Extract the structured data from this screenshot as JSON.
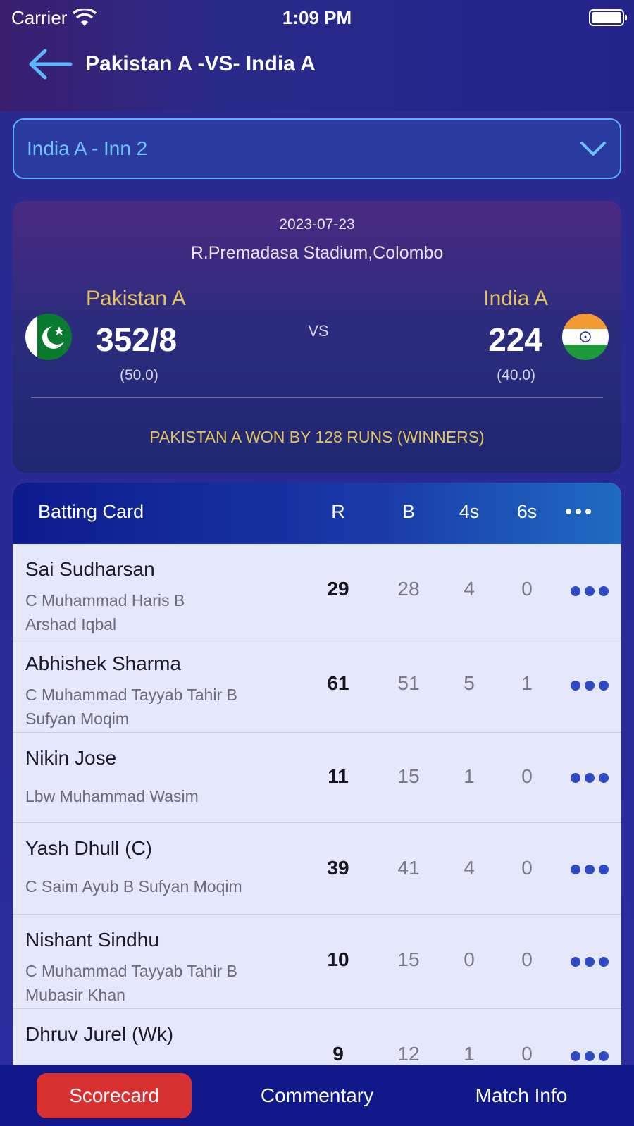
{
  "status_bar": {
    "carrier": "Carrier",
    "time": "1:09 PM"
  },
  "header": {
    "title": "Pakistan A -VS- India A",
    "back_icon": "back-arrow-icon"
  },
  "innings_selector": {
    "value": "India A - Inn 2",
    "icon": "chevron-down-icon"
  },
  "match": {
    "date": "2023-07-23",
    "venue": "R.Premadasa Stadium,Colombo",
    "vs": "VS",
    "team1": {
      "name": "Pakistan A",
      "score": "352/8",
      "overs": "(50.0)",
      "flag": "pakistan-flag-icon"
    },
    "team2": {
      "name": "India A",
      "score": "224",
      "overs": "(40.0)",
      "flag": "india-flag-icon"
    },
    "result": "PAKISTAN A WON BY 128 RUNS (WINNERS)"
  },
  "batting_card": {
    "title": "Batting Card",
    "columns": {
      "r": "R",
      "b": "B",
      "fours": "4s",
      "sixes": "6s"
    },
    "rows": [
      {
        "name": "Sai Sudharsan",
        "dismissal_1": "C Muhammad Haris B",
        "dismissal_2": "Arshad Iqbal",
        "r": "29",
        "b": "28",
        "fours": "4",
        "sixes": "0"
      },
      {
        "name": "Abhishek Sharma",
        "dismissal_1": "C Muhammad Tayyab Tahir B",
        "dismissal_2": "Sufyan Moqim",
        "r": "61",
        "b": "51",
        "fours": "5",
        "sixes": "1"
      },
      {
        "name": "Nikin Jose",
        "dismissal_1": "Lbw Muhammad Wasim",
        "dismissal_2": "",
        "r": "11",
        "b": "15",
        "fours": "1",
        "sixes": "0"
      },
      {
        "name": "Yash Dhull (C)",
        "dismissal_1": "C Saim Ayub B Sufyan Moqim",
        "dismissal_2": "",
        "r": "39",
        "b": "41",
        "fours": "4",
        "sixes": "0"
      },
      {
        "name": "Nishant Sindhu",
        "dismissal_1": "C Muhammad Tayyab Tahir B",
        "dismissal_2": "Mubasir Khan",
        "r": "10",
        "b": "15",
        "fours": "0",
        "sixes": "0"
      },
      {
        "name": "Dhruv Jurel (Wk)",
        "dismissal_1": "",
        "dismissal_2": "",
        "r": "9",
        "b": "12",
        "fours": "1",
        "sixes": "0"
      }
    ]
  },
  "tabs": {
    "scorecard": "Scorecard",
    "commentary": "Commentary",
    "match_info": "Match Info"
  },
  "colors": {
    "accent_gold": "#e3c45c",
    "active_tab": "#d63030",
    "link_blue": "#6ec3ff"
  }
}
